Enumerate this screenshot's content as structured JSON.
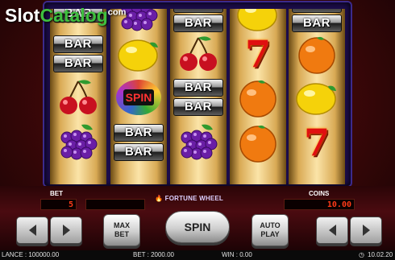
{
  "logo": {
    "brand": "Slot",
    "accent": "Catalog",
    "suffix": "com"
  },
  "reels": [
    [
      {
        "symbol": "bar"
      },
      {
        "symbol": "bar-double"
      },
      {
        "symbol": "cherry"
      },
      {
        "symbol": "grapes"
      }
    ],
    [
      {
        "symbol": "grapes"
      },
      {
        "symbol": "lemon"
      },
      {
        "symbol": "spin",
        "label": "SPIN"
      },
      {
        "symbol": "bar-double"
      }
    ],
    [
      {
        "symbol": "bar-double"
      },
      {
        "symbol": "cherry"
      },
      {
        "symbol": "bar-double"
      },
      {
        "symbol": "grapes"
      }
    ],
    [
      {
        "symbol": "lemon"
      },
      {
        "symbol": "seven"
      },
      {
        "symbol": "orange"
      },
      {
        "symbol": "orange"
      }
    ],
    [
      {
        "symbol": "bar-double"
      },
      {
        "symbol": "orange"
      },
      {
        "symbol": "lemon"
      },
      {
        "symbol": "seven"
      }
    ]
  ],
  "symbols": {
    "bar_label": "BAR",
    "seven_label": "7"
  },
  "panel": {
    "bet_label": "BET",
    "bet_value": "5",
    "coins_label": "COINS",
    "coins_value": "10.00",
    "feature_name": "FORTUNE WHEEL"
  },
  "buttons": {
    "max_bet": "MAX\nBET",
    "spin": "SPIN",
    "auto_play": "AUTO\nPLAY"
  },
  "status": {
    "balance": "LANCE : 100000.00",
    "bet": "BET : 2000.00",
    "win": "WIN : 0.00",
    "time": "10.02.20"
  },
  "colors": {
    "lcd": "#ff3a18",
    "frame": "#1b0c4a",
    "panel": "#4a0b10"
  }
}
